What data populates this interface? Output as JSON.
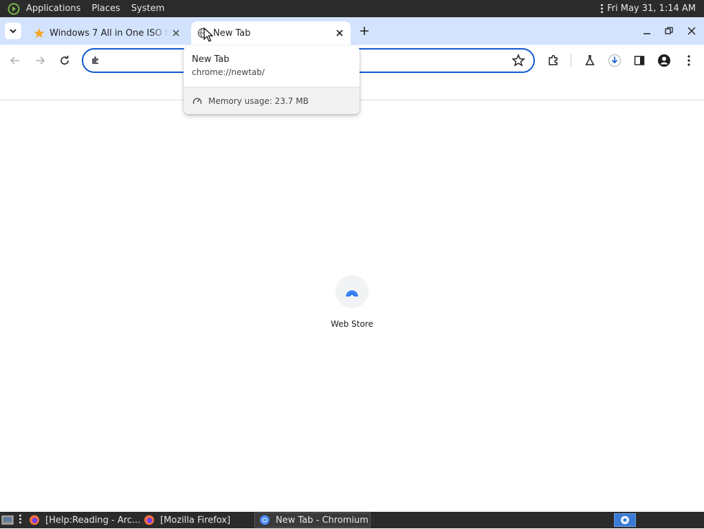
{
  "top_panel": {
    "menus": [
      "Applications",
      "Places",
      "System"
    ],
    "datetime": "Fri May 31,  1:14 AM"
  },
  "browser": {
    "tabs": [
      {
        "title": "Windows 7 All in One ISO ISO",
        "favicon": "star-icon",
        "active": false
      },
      {
        "title": "New Tab",
        "favicon": "globe-icon",
        "active": true
      }
    ],
    "omnibox": {
      "value": "",
      "placeholder": ""
    },
    "hover_card": {
      "title": "New Tab",
      "url": "chrome://newtab/",
      "memory": "Memory usage: 23.7 MB"
    },
    "toolbar_icons": [
      "back-icon",
      "forward-icon",
      "reload-icon",
      "bookmark-star-icon",
      "extensions-icon",
      "labs-flask-icon",
      "download-icon",
      "side-panel-icon",
      "profile-icon",
      "menu-kebab-icon"
    ]
  },
  "page": {
    "shortcuts": [
      {
        "label": "Web Store"
      }
    ]
  },
  "taskbar": {
    "tasks": [
      {
        "label": "[Help:Reading - Arc...",
        "icon": "firefox-icon"
      },
      {
        "label": "[Mozilla Firefox]",
        "icon": "firefox-icon"
      },
      {
        "label": "New Tab - Chromium",
        "icon": "chromium-icon",
        "active": true
      }
    ]
  },
  "colors": {
    "panel": "#2b2b2b",
    "tabstrip": "#d3e3fd",
    "accent": "#0b57d0"
  }
}
